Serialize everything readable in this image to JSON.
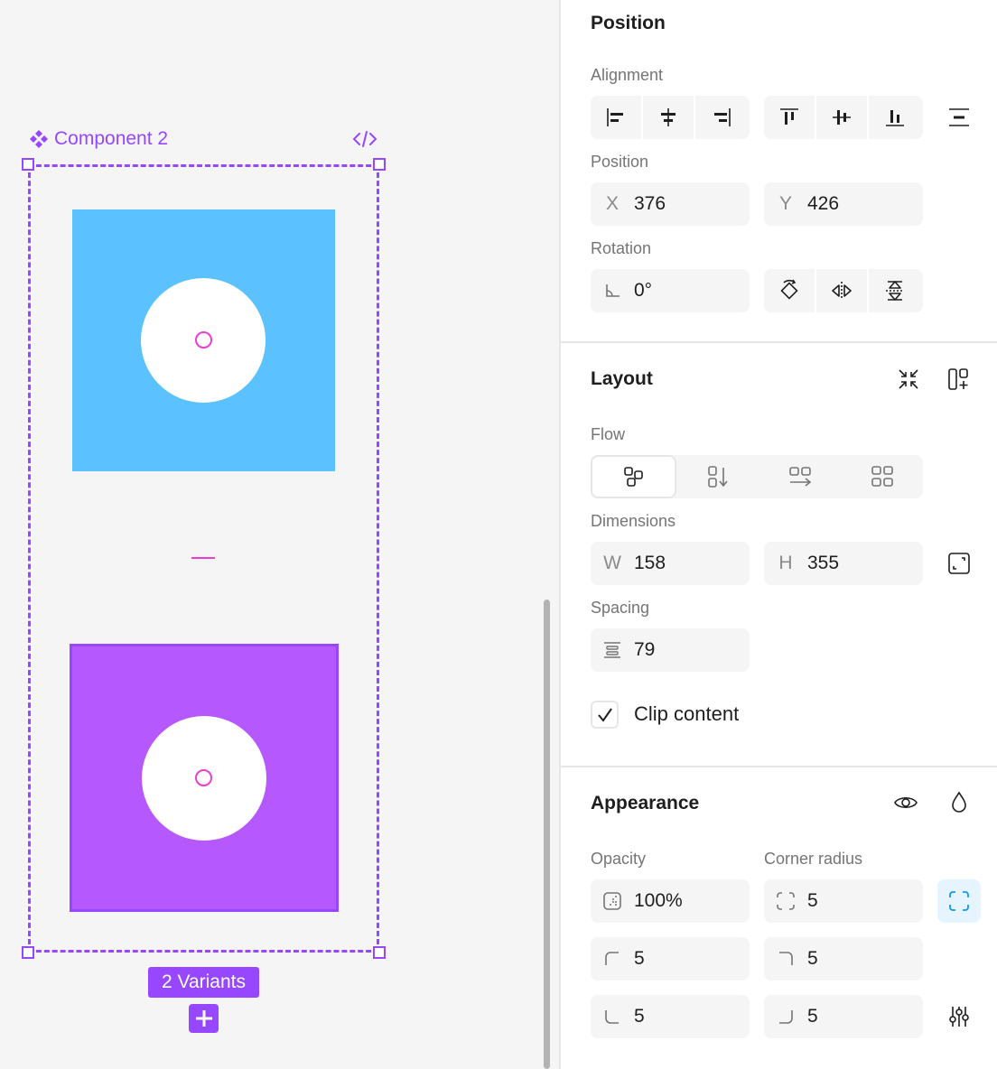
{
  "colors": {
    "selection": "#9747ff",
    "variant_a_fill": "#5bc2ff",
    "variant_b_fill": "#b559ff",
    "marker": "#ea3dd2",
    "active_blue": "#0d99ff"
  },
  "canvas": {
    "component_name": "Component 2",
    "component_icon": "component-icon",
    "code_icon": "code-icon",
    "variants_badge": "2 Variants",
    "add_variant_icon": "plus-icon"
  },
  "panel": {
    "position": {
      "title": "Position",
      "alignment_label": "Alignment",
      "position_label": "Position",
      "x_prefix": "X",
      "x_value": "376",
      "y_prefix": "Y",
      "y_value": "426",
      "rotation_label": "Rotation",
      "rotation_value": "0°"
    },
    "layout": {
      "title": "Layout",
      "flow_label": "Flow",
      "flow_selected": "freeform",
      "dimensions_label": "Dimensions",
      "w_prefix": "W",
      "w_value": "158",
      "h_prefix": "H",
      "h_value": "355",
      "spacing_label": "Spacing",
      "spacing_value": "79",
      "clip_label": "Clip content",
      "clip_checked": true
    },
    "appearance": {
      "title": "Appearance",
      "opacity_label": "Opacity",
      "opacity_value": "100%",
      "corner_label": "Corner radius",
      "corner_value": "5",
      "corner_tl": "5",
      "corner_tr": "5",
      "corner_bl": "5",
      "corner_br": "5"
    }
  }
}
